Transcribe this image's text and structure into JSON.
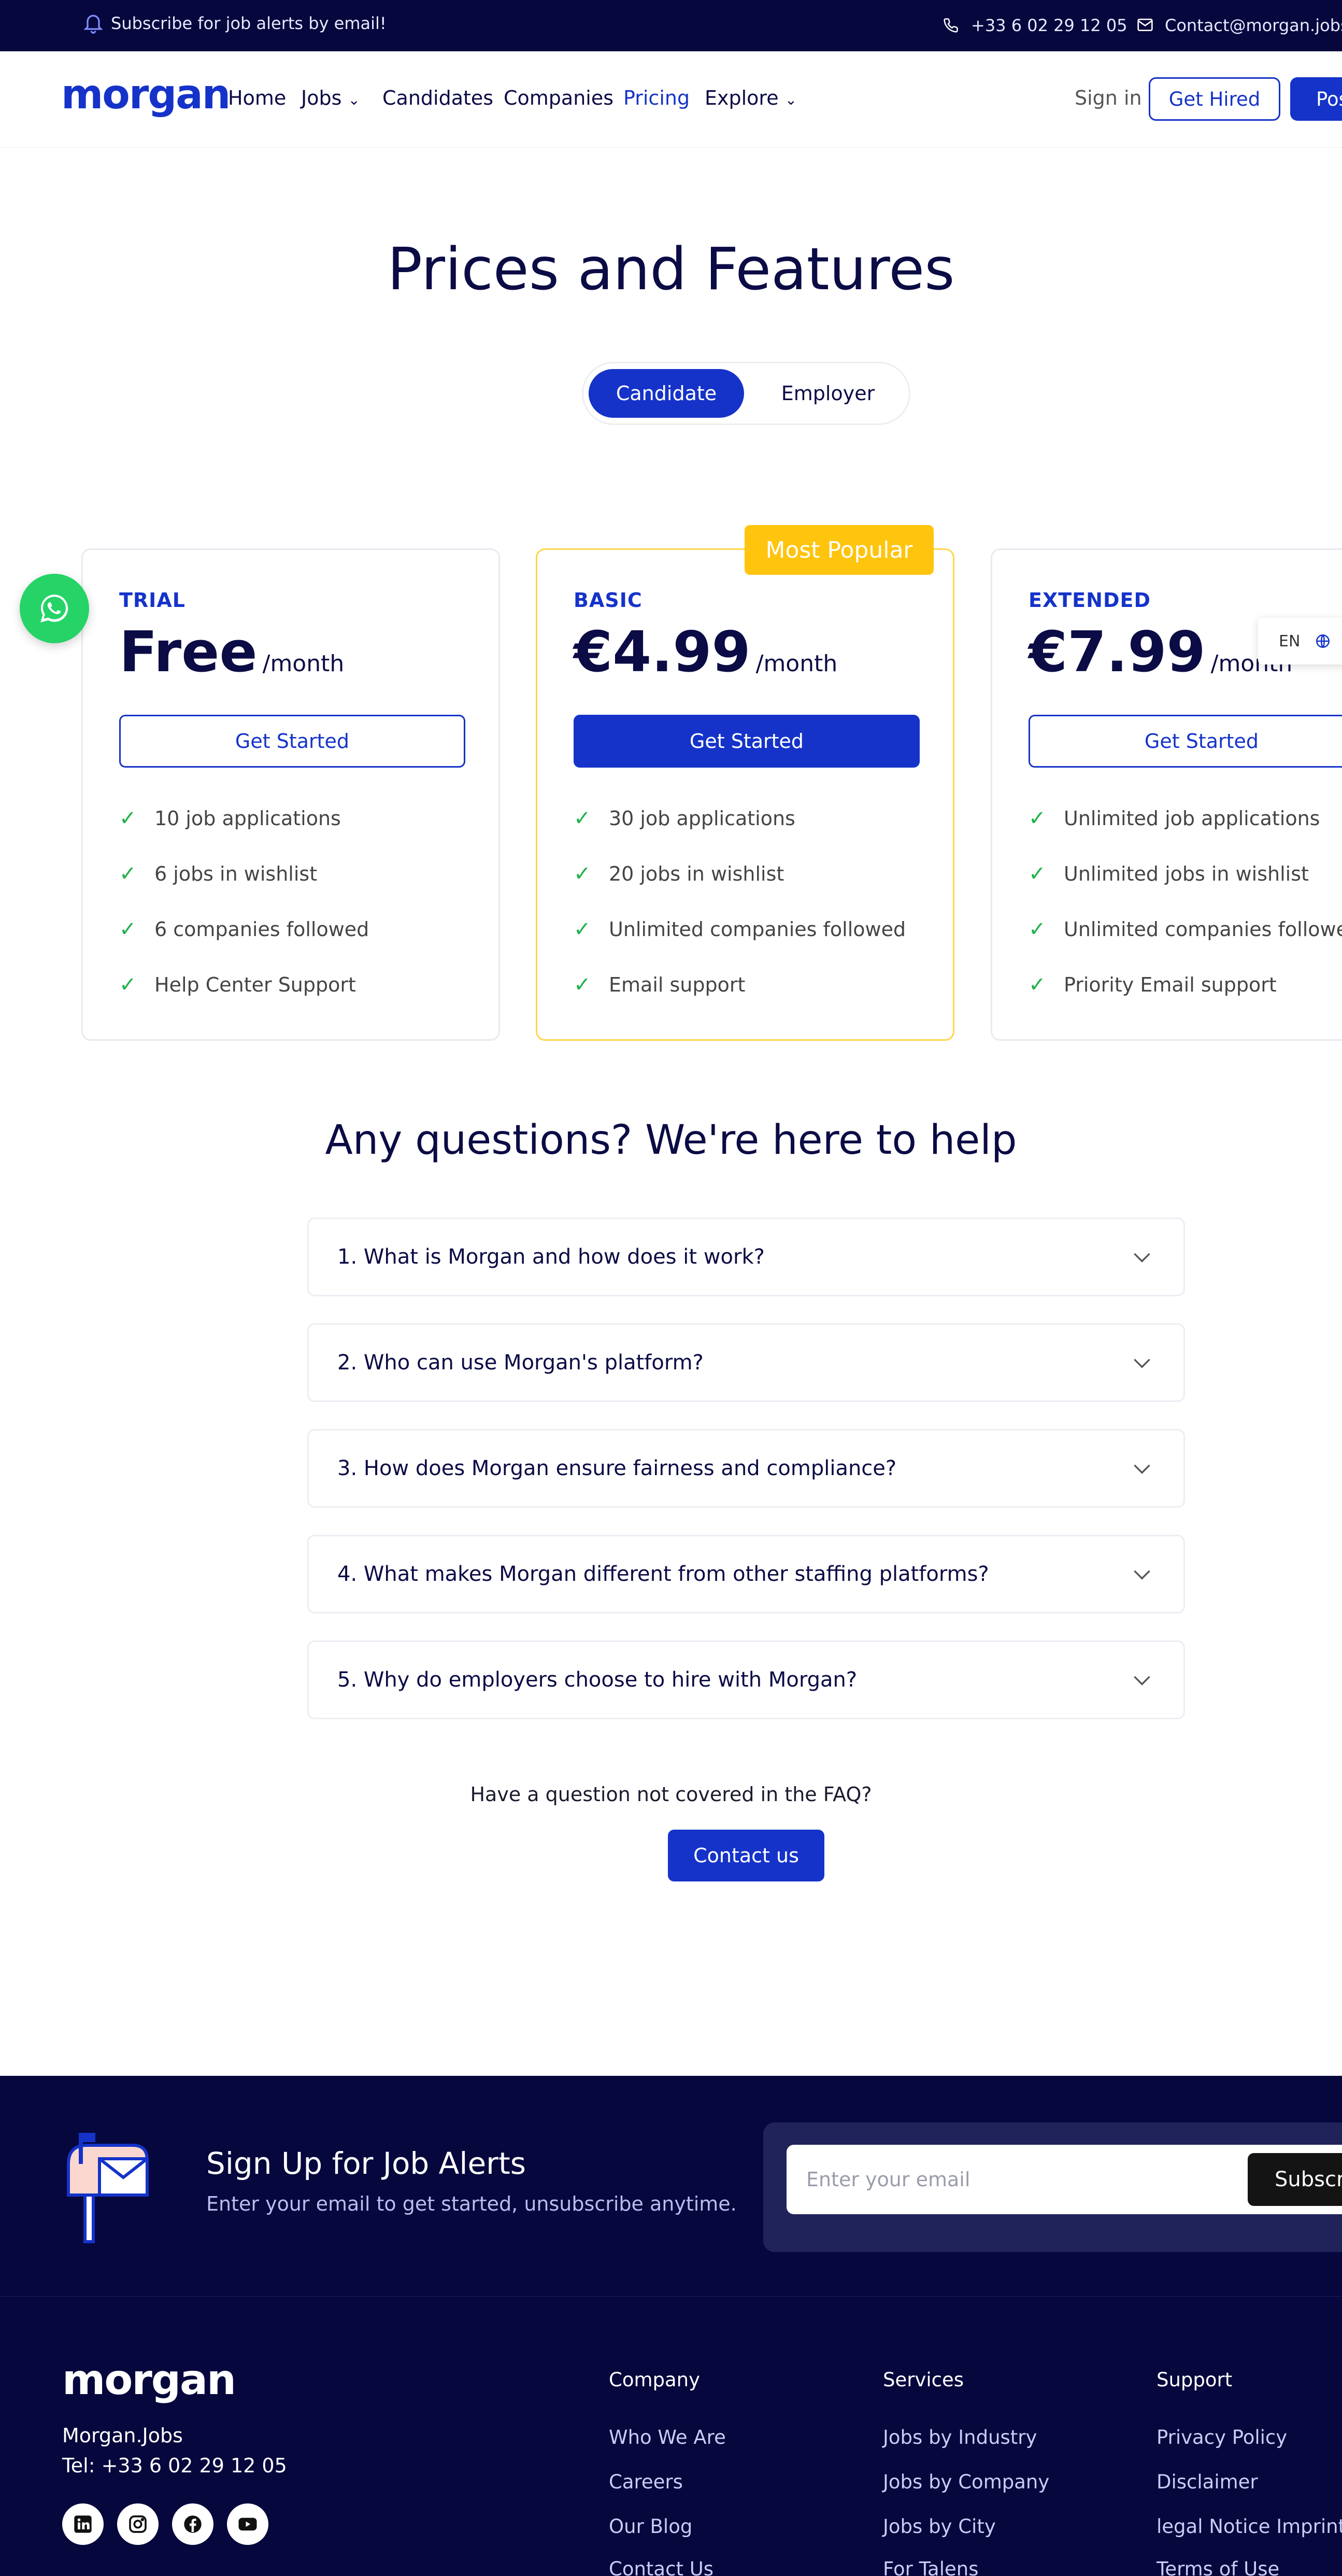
{
  "topbar": {
    "subscribe_text": "Subscribe for job alerts by email!",
    "phone": "+33 6 02 29 12 05",
    "email": "Contact@morgan.jobs"
  },
  "nav": {
    "logo": "morgan",
    "items": [
      "Home",
      "Jobs",
      "Candidates",
      "Companies",
      "Pricing",
      "Explore"
    ],
    "active": "Pricing",
    "sign_in": "Sign in",
    "get_hired": "Get Hired",
    "post_job": "Post a Job"
  },
  "hero": {
    "title": "Prices and Features",
    "toggle": [
      "Candidate",
      "Employer"
    ],
    "toggle_selected": "Candidate"
  },
  "plans": [
    {
      "tier": "TRIAL",
      "price": "Free",
      "period": "/month",
      "cta": "Get Started",
      "features": [
        "10 job applications",
        "6 jobs in wishlist",
        "6 companies followed",
        "Help Center Support"
      ]
    },
    {
      "tier": "BASIC",
      "price": "€4.99",
      "period": "/month",
      "cta": "Get Started",
      "badge": "Most Popular",
      "features": [
        "30 job applications",
        "20 jobs in wishlist",
        "Unlimited companies followed",
        "Email support"
      ]
    },
    {
      "tier": "EXTENDED",
      "price": "€7.99",
      "period": "/month",
      "cta": "Get Started",
      "features": [
        "Unlimited job applications",
        "Unlimited jobs in wishlist",
        "Unlimited companies followed",
        "Priority Email support"
      ]
    }
  ],
  "language": "EN",
  "faq": {
    "title": "Any questions? We're here to help",
    "questions": [
      "1. What is Morgan and how does it work?",
      "2. Who can use Morgan's platform?",
      "3. How does Morgan ensure fairness and compliance?",
      "4. What makes Morgan different from other staffing platforms?",
      "5. Why do employers choose to hire with Morgan?"
    ],
    "note": "Have a question not covered in the FAQ?",
    "contact_button": "Contact us"
  },
  "newsletter": {
    "title": "Sign Up for Job Alerts",
    "subtitle": "Enter your email to get started, unsubscribe anytime.",
    "placeholder": "Enter your email",
    "button": "Subscribe"
  },
  "footer": {
    "logo": "morgan",
    "company_name": "Morgan.Jobs",
    "tel": "Tel: +33 6 02 29 12 05",
    "social_icons": [
      "linkedin-icon",
      "instagram-icon",
      "facebook-icon",
      "youtube-icon"
    ],
    "columns": [
      {
        "heading": "Company",
        "links": [
          "Who We Are",
          "Careers",
          "Our Blog",
          "Contact Us"
        ]
      },
      {
        "heading": "Services",
        "links": [
          "Jobs by Industry",
          "Jobs by Company",
          "Jobs by City",
          "For Talens"
        ]
      },
      {
        "heading": "Support",
        "links": [
          "Privacy Policy",
          "Disclaimer",
          "legal Notice Imprint",
          "Terms of Use"
        ]
      }
    ]
  },
  "colors": {
    "brand_blue": "#1533c9",
    "navy": "#06073d",
    "popular_yellow": "#ffc40e",
    "check_green": "#21b24b",
    "whatsapp_green": "#25d366"
  }
}
